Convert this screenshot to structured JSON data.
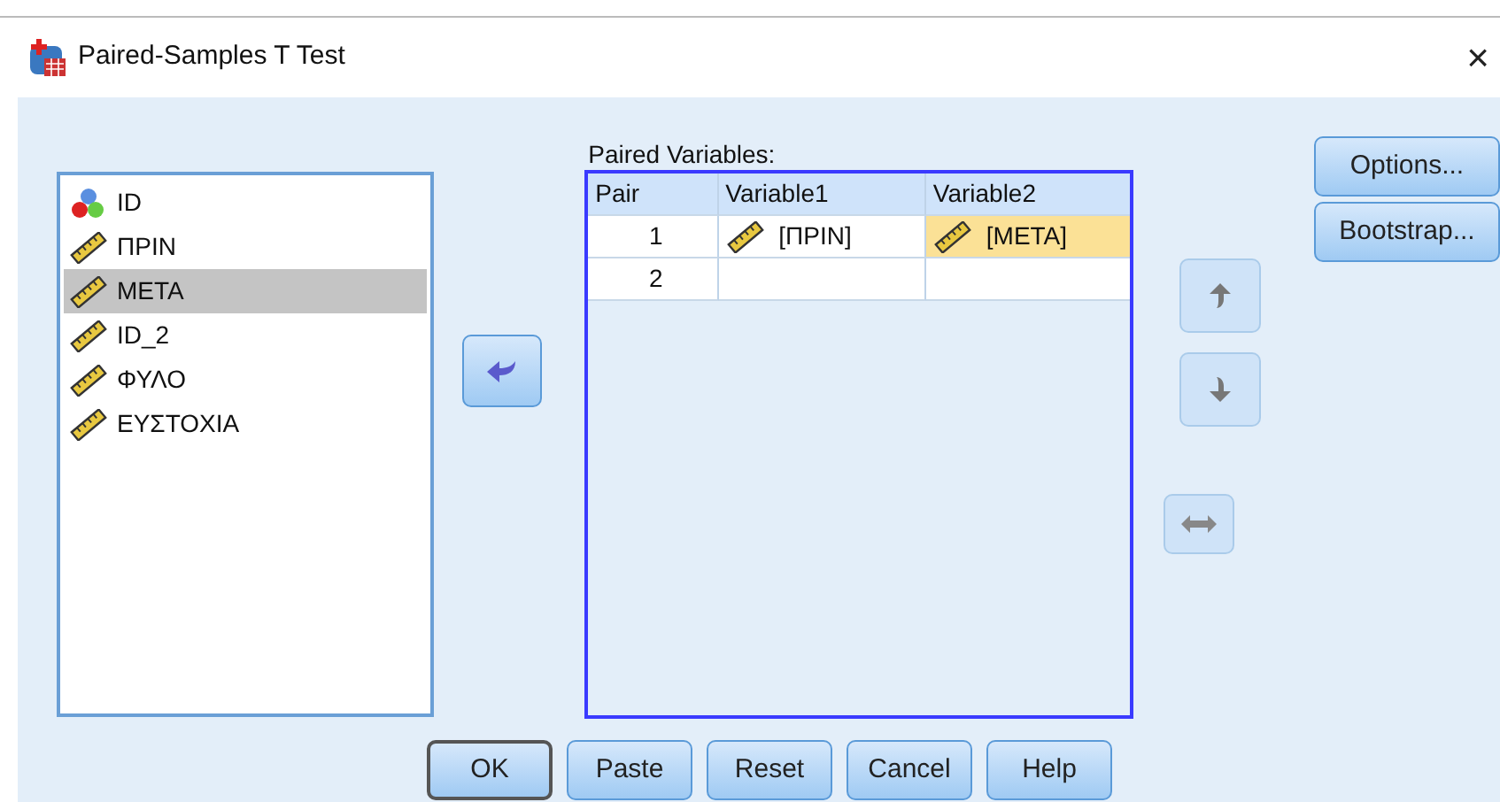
{
  "window": {
    "title": "Paired-Samples T Test",
    "close": "×"
  },
  "variables": [
    {
      "name": "ID",
      "kind": "nominal",
      "selected": false
    },
    {
      "name": "ΠΡΙΝ",
      "kind": "scale",
      "selected": false
    },
    {
      "name": "ΜΕΤΑ",
      "kind": "scale",
      "selected": true
    },
    {
      "name": "ID_2",
      "kind": "scale",
      "selected": false
    },
    {
      "name": "ΦΥΛΟ",
      "kind": "scale",
      "selected": false
    },
    {
      "name": "ΕΥΣΤΟΧΙΑ",
      "kind": "scale",
      "selected": false
    }
  ],
  "move_button": {
    "disabled": false
  },
  "paired_variables": {
    "label": "Paired Variables:",
    "columns": [
      "Pair",
      "Variable1",
      "Variable2"
    ],
    "rows": [
      {
        "cells": [
          {
            "text": "1"
          },
          {
            "text": "[ΠΡΙΝ]",
            "kind": "scale",
            "selected": false
          },
          {
            "text": "[ΜΕΤΑ]",
            "kind": "scale",
            "selected": true
          }
        ]
      },
      {
        "cells": [
          {
            "text": "2"
          },
          {
            "text": ""
          },
          {
            "text": ""
          }
        ]
      }
    ]
  },
  "order_buttons": [
    {
      "kind": "up",
      "disabled": true
    },
    {
      "kind": "down",
      "disabled": true
    }
  ],
  "swap_button": {
    "disabled": true
  },
  "side_buttons": [
    {
      "label": "Options..."
    },
    {
      "label": "Bootstrap..."
    }
  ],
  "buttons": [
    {
      "label": "OK",
      "default": true
    },
    {
      "label": "Paste",
      "default": false
    },
    {
      "label": "Reset",
      "default": false
    },
    {
      "label": "Cancel",
      "default": false
    },
    {
      "label": "Help",
      "default": false
    }
  ]
}
